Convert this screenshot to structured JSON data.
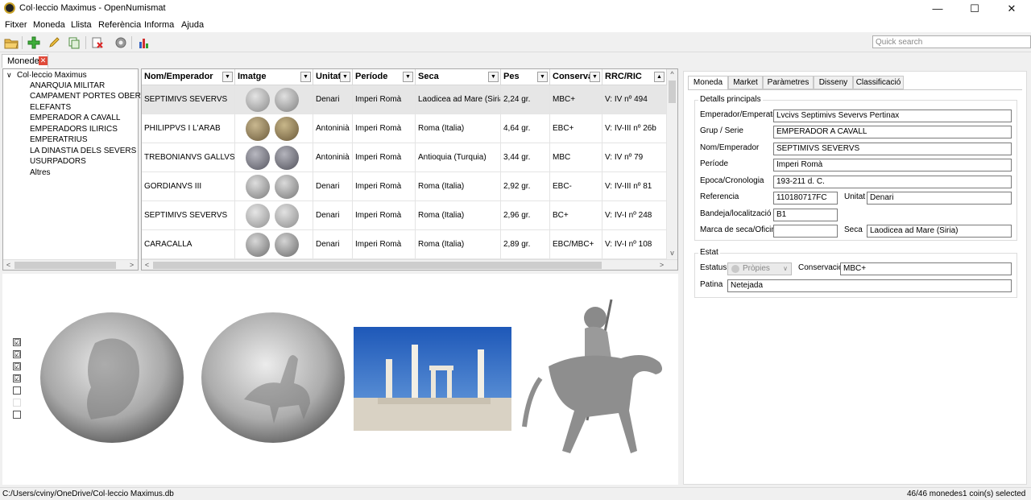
{
  "window": {
    "title": "Col·leccio Maximus - OpenNumismat",
    "minimize": "—",
    "maximize": "☐",
    "close": "✕"
  },
  "menu": [
    "Fitxer",
    "Moneda",
    "Llista",
    "Referència",
    "Informa",
    "Ajuda"
  ],
  "toolbar": {
    "icons": [
      "open-folder-icon",
      "add-icon",
      "edit-pencil-icon",
      "clone-icon",
      "delete-icon",
      "settings-gear-icon",
      "statistics-chart-icon"
    ],
    "search_placeholder": "Quick search"
  },
  "doc_tab": {
    "label": "Monedes",
    "close": "✕"
  },
  "tree": {
    "root": "Col·leccio Maximus",
    "expander": "∨",
    "items": [
      "ANARQUIA MILITAR",
      "CAMPAMENT PORTES OBERTES",
      "ELEFANTS",
      "EMPERADOR A CAVALL",
      "EMPERADORS ILIRICS",
      "EMPERATRIUS",
      "LA DINASTIA DELS SEVERS",
      "USURPADORS",
      "Altres"
    ]
  },
  "table": {
    "columns": [
      "Nom/Emperador",
      "Imatge",
      "Unitat",
      "Període",
      "Seca",
      "Pes",
      "Conservac",
      "RRC/RIC"
    ],
    "rows": [
      {
        "nom": "SEPTIMIVS SEVERVS",
        "unitat": "Denari",
        "periode": "Imperi Romà",
        "seca": "Laodicea ad Mare (Siria)",
        "pes": "2,24 gr.",
        "cons": "MBC+",
        "ric": "V: IV nº 494"
      },
      {
        "nom": "PHILIPPVS I L'ARAB",
        "unitat": "Antoninià",
        "periode": "Imperi Romà",
        "seca": "Roma (Italia)",
        "pes": "4,64 gr.",
        "cons": "EBC+",
        "ric": "V: IV-III nº 26b"
      },
      {
        "nom": "TREBONIANVS GALLVS",
        "unitat": "Antoninià",
        "periode": "Imperi Romà",
        "seca": "Antioquia (Turquia)",
        "pes": "3,44 gr.",
        "cons": "MBC",
        "ric": "V: IV nº 79"
      },
      {
        "nom": "GORDIANVS III",
        "unitat": "Denari",
        "periode": "Imperi Romà",
        "seca": "Roma (Italia)",
        "pes": "2,92 gr.",
        "cons": "EBC-",
        "ric": "V: IV-III nº 81"
      },
      {
        "nom": "SEPTIMIVS SEVERVS",
        "unitat": "Denari",
        "periode": "Imperi Romà",
        "seca": "Roma (Italia)",
        "pes": "2,96 gr.",
        "cons": "BC+",
        "ric": "V: IV-I nº 248"
      },
      {
        "nom": "CARACALLA",
        "unitat": "Denari",
        "periode": "Imperi Romà",
        "seca": "Roma (Italia)",
        "pes": "2,89 gr.",
        "cons": "EBC/MBC+",
        "ric": "V: IV-I nº 108"
      }
    ]
  },
  "image_checkboxes": [
    "☑",
    "☑",
    "☑",
    "☑",
    "",
    "",
    ""
  ],
  "details": {
    "tabs": [
      "Moneda",
      "Market",
      "Paràmetres",
      "Disseny",
      "Classificació"
    ],
    "main_group": "Detalls principals",
    "emperador_label": "Emperador/Emperatriu",
    "emperador": "Lvcivs Septimivs Severvs Pertinax",
    "grup_label": "Grup / Serie",
    "grup": "EMPERADOR A CAVALL",
    "nom_label": "Nom/Emperador",
    "nom": "SEPTIMIVS SEVERVS",
    "periode_label": "Període",
    "periode": "Imperi Romà",
    "epoca_label": "Epoca/Cronologia",
    "epoca": "193-211 d. C.",
    "referencia_label": "Referencia",
    "referencia": "110180717FC",
    "unitat_label": "Unitat",
    "unitat": "Denari",
    "bandeja_label": "Bandeja/localització",
    "bandeja": "B1",
    "marca_label": "Marca de seca/Oficina",
    "marca": "",
    "seca_label": "Seca",
    "seca": "Laodicea ad Mare (Siria)",
    "estat_group": "Estat",
    "estatus_label": "Estatus",
    "estatus": "Pròpies",
    "conservacio_label": "Conservació",
    "conservacio": "MBC+",
    "patina_label": "Patina",
    "patina": "Netejada"
  },
  "status": {
    "path": "C:/Users/cviny/OneDrive/Col·leccio Maximus.db",
    "count": "46/46 monedes",
    "selected": "1 coin(s) selected"
  }
}
